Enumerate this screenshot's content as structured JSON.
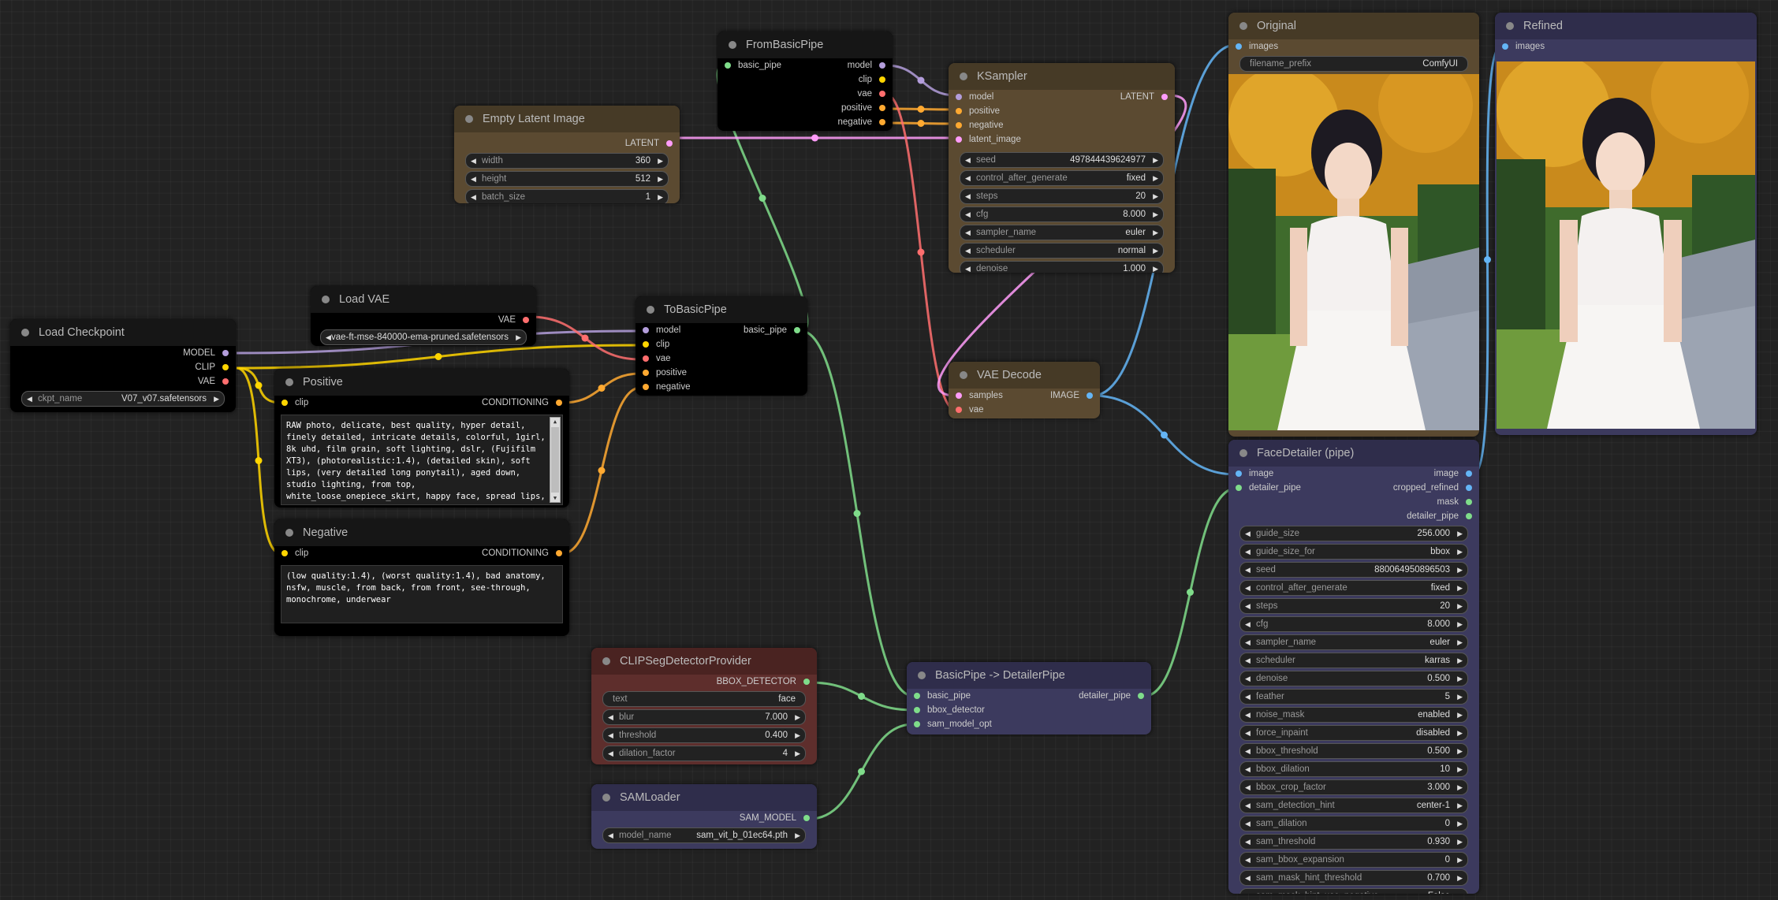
{
  "colors": {
    "model": "#b39ddb",
    "clip": "#ffd500",
    "vae": "#ff6e6e",
    "conditioning": "#ffa931",
    "latent": "#ff9cf9",
    "image": "#64b5f6",
    "pipe": "#7fdc8a",
    "bbox": "#7fdc8a",
    "mask": "#7fdc8a"
  },
  "nodes": {
    "load_checkpoint": {
      "title": "Load Checkpoint",
      "outputs": [
        "MODEL",
        "CLIP",
        "VAE"
      ],
      "widgets": [
        {
          "label": "ckpt_name",
          "value": "V07_v07.safetensors"
        }
      ]
    },
    "load_vae": {
      "title": "Load VAE",
      "outputs": [
        "VAE"
      ],
      "widgets": [
        {
          "label": "vae_name",
          "value": "vae-ft-mse-840000-ema-pruned.safetensors"
        }
      ]
    },
    "empty_latent": {
      "title": "Empty Latent Image",
      "outputs": [
        "LATENT"
      ],
      "widgets": [
        {
          "label": "width",
          "value": "360"
        },
        {
          "label": "height",
          "value": "512"
        },
        {
          "label": "batch_size",
          "value": "1"
        }
      ]
    },
    "positive": {
      "title": "Positive",
      "inputs": [
        "clip"
      ],
      "outputs": [
        "CONDITIONING"
      ],
      "text": "RAW photo, delicate, best quality, hyper detail, finely detailed, intricate details, colorful, 1girl, 8k uhd, film grain, soft lighting, dslr, (Fujifilm XT3), (photorealistic:1.4), (detailed skin), soft lips, (very detailed long ponytail), aged down, studio lighting, from top, white_loose_onepiece_skirt, happy face, spread lips, (walking), (central park, tree, flowers, cloud, sunshine), date, small breast"
    },
    "negative": {
      "title": "Negative",
      "inputs": [
        "clip"
      ],
      "outputs": [
        "CONDITIONING"
      ],
      "text": "(low quality:1.4), (worst quality:1.4), bad anatomy, nsfw, muscle, from back, from front, see-through, monochrome, underwear"
    },
    "from_basic_pipe": {
      "title": "FromBasicPipe",
      "inputs": [
        "basic_pipe"
      ],
      "outputs": [
        "model",
        "clip",
        "vae",
        "positive",
        "negative"
      ]
    },
    "to_basic_pipe": {
      "title": "ToBasicPipe",
      "inputs": [
        "model",
        "clip",
        "vae",
        "positive",
        "negative"
      ],
      "outputs": [
        "basic_pipe"
      ]
    },
    "ksampler": {
      "title": "KSampler",
      "inputs": [
        "model",
        "positive",
        "negative",
        "latent_image"
      ],
      "outputs": [
        "LATENT"
      ],
      "widgets": [
        {
          "label": "seed",
          "value": "497844439624977"
        },
        {
          "label": "control_after_generate",
          "value": "fixed"
        },
        {
          "label": "steps",
          "value": "20"
        },
        {
          "label": "cfg",
          "value": "8.000"
        },
        {
          "label": "sampler_name",
          "value": "euler"
        },
        {
          "label": "scheduler",
          "value": "normal"
        },
        {
          "label": "denoise",
          "value": "1.000"
        }
      ]
    },
    "vae_decode": {
      "title": "VAE Decode",
      "inputs": [
        "samples",
        "vae"
      ],
      "outputs": [
        "IMAGE"
      ]
    },
    "original": {
      "title": "Original",
      "inputs": [
        "images"
      ],
      "widgets": [
        {
          "label": "filename_prefix",
          "value": "ComfyUI"
        }
      ]
    },
    "refined": {
      "title": "Refined",
      "inputs": [
        "images"
      ]
    },
    "face_detailer": {
      "title": "FaceDetailer (pipe)",
      "inputs": [
        "image",
        "detailer_pipe"
      ],
      "outputs": [
        "image",
        "cropped_refined",
        "mask",
        "detailer_pipe"
      ],
      "widgets": [
        {
          "label": "guide_size",
          "value": "256.000"
        },
        {
          "label": "guide_size_for",
          "value": "bbox"
        },
        {
          "label": "seed",
          "value": "880064950896503"
        },
        {
          "label": "control_after_generate",
          "value": "fixed"
        },
        {
          "label": "steps",
          "value": "20"
        },
        {
          "label": "cfg",
          "value": "8.000"
        },
        {
          "label": "sampler_name",
          "value": "euler"
        },
        {
          "label": "scheduler",
          "value": "karras"
        },
        {
          "label": "denoise",
          "value": "0.500"
        },
        {
          "label": "feather",
          "value": "5"
        },
        {
          "label": "noise_mask",
          "value": "enabled"
        },
        {
          "label": "force_inpaint",
          "value": "disabled"
        },
        {
          "label": "bbox_threshold",
          "value": "0.500"
        },
        {
          "label": "bbox_dilation",
          "value": "10"
        },
        {
          "label": "bbox_crop_factor",
          "value": "3.000"
        },
        {
          "label": "sam_detection_hint",
          "value": "center-1"
        },
        {
          "label": "sam_dilation",
          "value": "0"
        },
        {
          "label": "sam_threshold",
          "value": "0.930"
        },
        {
          "label": "sam_bbox_expansion",
          "value": "0"
        },
        {
          "label": "sam_mask_hint_threshold",
          "value": "0.700"
        },
        {
          "label": "sam_mask_hint_use_negative",
          "value": "False"
        }
      ]
    },
    "clipseg": {
      "title": "CLIPSegDetectorProvider",
      "outputs": [
        "BBOX_DETECTOR"
      ],
      "text_widget": {
        "label": "text",
        "value": "face"
      },
      "widgets": [
        {
          "label": "blur",
          "value": "7.000"
        },
        {
          "label": "threshold",
          "value": "0.400"
        },
        {
          "label": "dilation_factor",
          "value": "4"
        }
      ]
    },
    "sam_loader": {
      "title": "SAMLoader",
      "outputs": [
        "SAM_MODEL"
      ],
      "widgets": [
        {
          "label": "model_name",
          "value": "sam_vit_b_01ec64.pth"
        }
      ]
    },
    "basic_to_detailer": {
      "title": "BasicPipe -> DetailerPipe",
      "inputs": [
        "basic_pipe",
        "bbox_detector",
        "sam_model_opt"
      ],
      "outputs": [
        "detailer_pipe"
      ]
    }
  }
}
